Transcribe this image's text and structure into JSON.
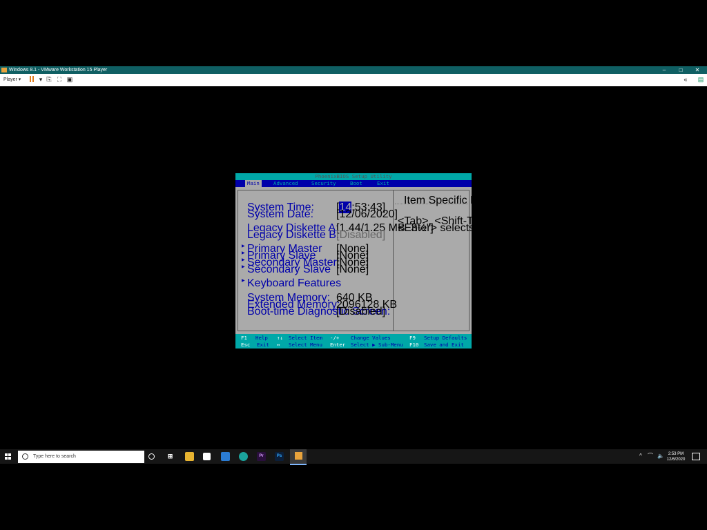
{
  "window": {
    "title": "Windows 8.1 - VMware Workstation 15 Player",
    "minimize": "–",
    "restore": "□",
    "close": "✕"
  },
  "toolbar": {
    "player_menu": "Player ▾"
  },
  "bios": {
    "title": "PhoenixBIOS Setup Utility",
    "menu": [
      "Main",
      "Advanced",
      "Security",
      "Boot",
      "Exit"
    ],
    "active_menu": "Main",
    "fields": {
      "system_time": {
        "label": "System Time:",
        "value_cursor": "14",
        "value_rest": ":53:43]"
      },
      "system_date": {
        "label": "System Date:",
        "value": "[12/06/2020]"
      },
      "legacy_a": {
        "label": "Legacy Diskette A:",
        "value": "[1.44/1.25 MB  3½\"]"
      },
      "legacy_b": {
        "label": "Legacy Diskette B:",
        "value": "[Disabled]"
      },
      "primary_master": {
        "label": "Primary Master",
        "value": "[None]"
      },
      "primary_slave": {
        "label": "Primary Slave",
        "value": "[None]"
      },
      "secondary_master": {
        "label": "Secondary Master",
        "value": "[None]"
      },
      "secondary_slave": {
        "label": "Secondary Slave",
        "value": "[None]"
      },
      "keyboard_features": {
        "label": "Keyboard Features"
      },
      "system_memory": {
        "label": "System Memory:",
        "value": "640 KB"
      },
      "extended_memory": {
        "label": "Extended Memory:",
        "value": "2096128 KB"
      },
      "boot_diag": {
        "label": "Boot-time Diagnostic Screen:",
        "value": "[Disabled]"
      }
    },
    "help": {
      "title": "Item Specific Help",
      "line1": "<Tab>, <Shift-Tab>, or",
      "line2": "<Enter> selects field."
    },
    "footer": {
      "row1": {
        "k1": "F1",
        "d1": "Help",
        "k2": "↑↓",
        "d2": "Select Item",
        "k3": "-/+",
        "d3": "Change Values",
        "k4": "F9",
        "d4": "Setup Defaults"
      },
      "row2": {
        "k1": "Esc",
        "d1": "Exit",
        "k2": "↔",
        "d2": "Select Menu",
        "k3": "Enter",
        "d3": "Select ▶ Sub-Menu",
        "k4": "F10",
        "d4": "Save and Exit"
      }
    }
  },
  "taskbar": {
    "search_placeholder": "Type here to search",
    "time": "2:53 PM",
    "date": "12/6/2020"
  }
}
